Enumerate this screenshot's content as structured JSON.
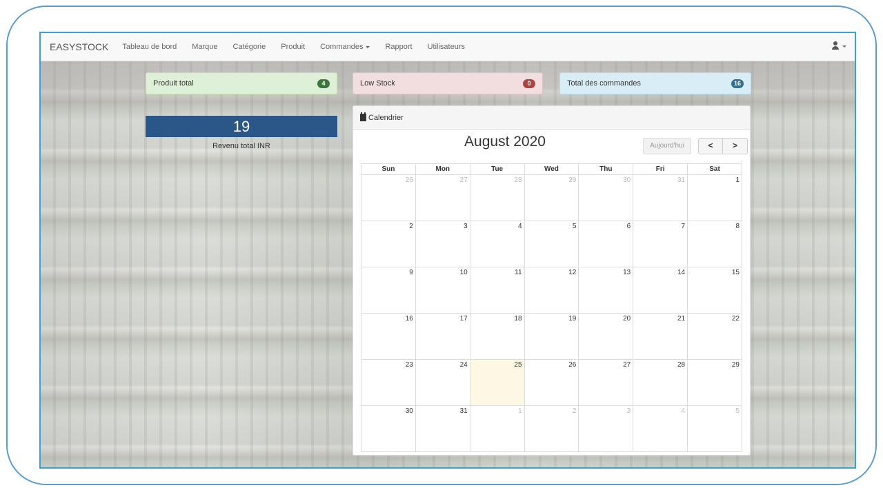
{
  "navbar": {
    "brand": "EASYSTOCK",
    "items": [
      "Tableau de bord",
      "Marque",
      "Catégorie",
      "Produit",
      "Commandes",
      "Rapport",
      "Utilisateurs"
    ]
  },
  "stats": {
    "products": {
      "title": "Produit total",
      "count": "4"
    },
    "low_stock": {
      "title": "Low Stock",
      "count": "0"
    },
    "orders": {
      "title": "Total des commandes",
      "count": "16"
    }
  },
  "revenue": {
    "value": "19",
    "label": "Revenu total INR"
  },
  "calendar": {
    "header": "Calendrier",
    "month": "August 2020",
    "today_label": "Aujourd'hui",
    "prev_label": "<",
    "next_label": ">",
    "weekdays": [
      "Sun",
      "Mon",
      "Tue",
      "Wed",
      "Thu",
      "Fri",
      "Sat"
    ],
    "weeks": [
      [
        {
          "d": "26",
          "o": true
        },
        {
          "d": "27",
          "o": true
        },
        {
          "d": "28",
          "o": true
        },
        {
          "d": "29",
          "o": true
        },
        {
          "d": "30",
          "o": true
        },
        {
          "d": "31",
          "o": true
        },
        {
          "d": "1"
        }
      ],
      [
        {
          "d": "2"
        },
        {
          "d": "3"
        },
        {
          "d": "4"
        },
        {
          "d": "5"
        },
        {
          "d": "6"
        },
        {
          "d": "7"
        },
        {
          "d": "8"
        }
      ],
      [
        {
          "d": "9"
        },
        {
          "d": "10"
        },
        {
          "d": "11"
        },
        {
          "d": "12"
        },
        {
          "d": "13"
        },
        {
          "d": "14"
        },
        {
          "d": "15"
        }
      ],
      [
        {
          "d": "16"
        },
        {
          "d": "17"
        },
        {
          "d": "18"
        },
        {
          "d": "19"
        },
        {
          "d": "20"
        },
        {
          "d": "21"
        },
        {
          "d": "22"
        }
      ],
      [
        {
          "d": "23"
        },
        {
          "d": "24"
        },
        {
          "d": "25",
          "t": true
        },
        {
          "d": "26"
        },
        {
          "d": "27"
        },
        {
          "d": "28"
        },
        {
          "d": "29"
        }
      ],
      [
        {
          "d": "30"
        },
        {
          "d": "31"
        },
        {
          "d": "1",
          "o": true
        },
        {
          "d": "2",
          "o": true
        },
        {
          "d": "3",
          "o": true
        },
        {
          "d": "4",
          "o": true
        },
        {
          "d": "5",
          "o": true
        }
      ]
    ]
  },
  "colors": {
    "brand_blue": "#2a5788",
    "success": "#3c763d",
    "danger": "#a94442",
    "info": "#31708f",
    "today_highlight": "#fcf8e3"
  },
  "icons": [
    "user-icon",
    "calendar-icon",
    "caret-down-icon"
  ]
}
